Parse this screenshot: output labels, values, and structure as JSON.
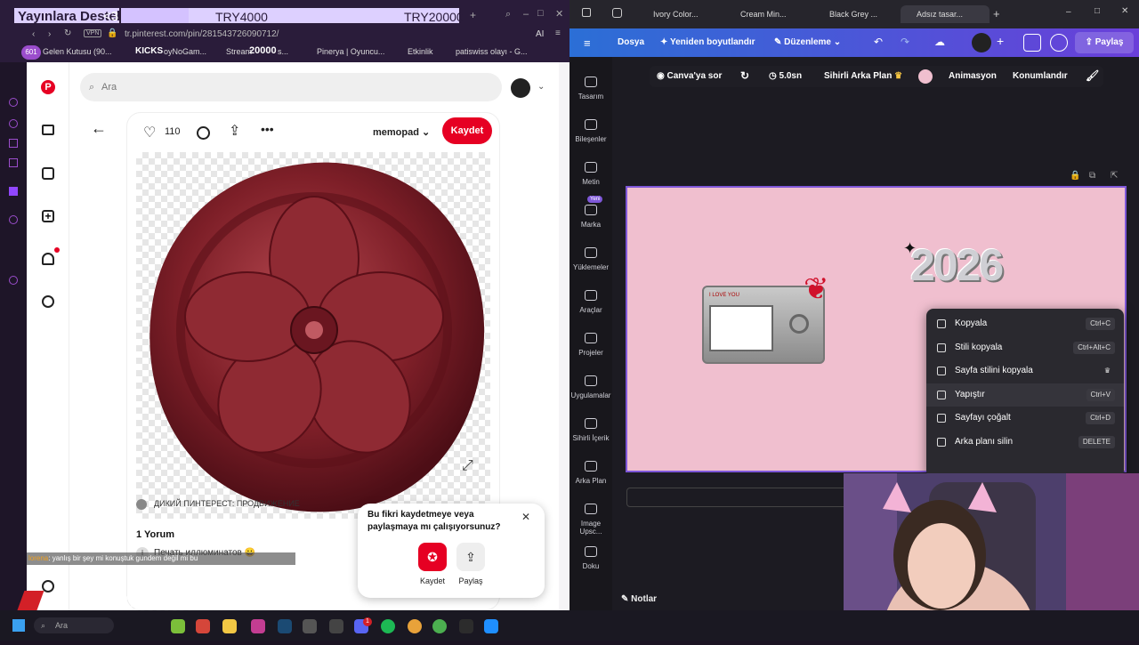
{
  "stream_banner": {
    "title": "Yayınlara Destek",
    "suffix": "<3",
    "goal_current": "TRY4000",
    "goal_target": "TRY20000",
    "progress": 0.2
  },
  "left_browser": {
    "url": "tr.pinterest.com/pin/281543726090712/",
    "vpn": "VPN",
    "ai": "AI",
    "bookmarks": [
      "601",
      "Gelen Kutusu (90...",
      "KICKS",
      "oyNoGam...",
      "Stream",
      "20000",
      "s...",
      "Pinerya | Oyuncu...",
      "Etkinlik",
      "patiswiss olayı - G..."
    ]
  },
  "pinterest": {
    "search_placeholder": "Ara",
    "like_count": "110",
    "board_name": "memopad",
    "save_button": "Kaydet",
    "source_line": "ДИКИЙ ПИНТЕРЕСТ: ПРОДВИЖЕНИЕ",
    "comment_count": "1 Yorum",
    "comment_text": "Печать иллюминатов 😀",
    "comment_prefix": "i",
    "popup": {
      "title": "Bu fikri kaydetmeye veya paylaşmaya mı çalışıyorsunuz?",
      "save_label": "Kaydet",
      "share_label": "Paylaş"
    }
  },
  "chat_overlay": {
    "user": "lorena",
    "text": ": yanlış bir şey mi konuştuk gundem değil mi bu"
  },
  "watermark": "DyNoGame",
  "right_browser": {
    "tabs": [
      "Ivory Color...",
      "Cream Min...",
      "Black Grey ...",
      "Adsız tasar..."
    ]
  },
  "canva": {
    "menu": {
      "file": "Dosya",
      "resize": "Yeniden boyutlandır",
      "edit": "Düzenleme",
      "share": "Paylaş"
    },
    "toolbar": {
      "ask": "Canva'ya sor",
      "duration": "5.0sn",
      "magic_bg": "Sihirli Arka Plan",
      "animation": "Animasyon",
      "position": "Konumlandır"
    },
    "sidebar": [
      {
        "label": "Tasarım",
        "badge": ""
      },
      {
        "label": "Bileşenler",
        "badge": ""
      },
      {
        "label": "Metin",
        "badge": ""
      },
      {
        "label": "Marka",
        "badge": "Yeni"
      },
      {
        "label": "Yüklemeler",
        "badge": ""
      },
      {
        "label": "Araçlar",
        "badge": ""
      },
      {
        "label": "Projeler",
        "badge": ""
      },
      {
        "label": "Uygulamalar",
        "badge": ""
      },
      {
        "label": "Sihirli İçerik",
        "badge": ""
      },
      {
        "label": "Arka Plan",
        "badge": ""
      },
      {
        "label": "Image Upsc...",
        "badge": ""
      },
      {
        "label": "Doku",
        "badge": ""
      }
    ],
    "canvas_text": "2026",
    "camera_label": "I LOVE YOU",
    "notes": "Notlar",
    "context_menu": [
      {
        "label": "Kopyala",
        "shortcut": "Ctrl+C"
      },
      {
        "label": "Stili kopyala",
        "shortcut": "Ctrl+Alt+C"
      },
      {
        "label": "Sayfa stilini kopyala",
        "shortcut": "♛"
      },
      {
        "label": "Yapıştır",
        "shortcut": "Ctrl+V"
      },
      {
        "label": "Sayfayı çoğalt",
        "shortcut": "Ctrl+D"
      },
      {
        "label": "Arka planı silin",
        "shortcut": "DELETE"
      }
    ]
  },
  "taskbar": {
    "search": "Ara",
    "notification_badge": "1"
  }
}
